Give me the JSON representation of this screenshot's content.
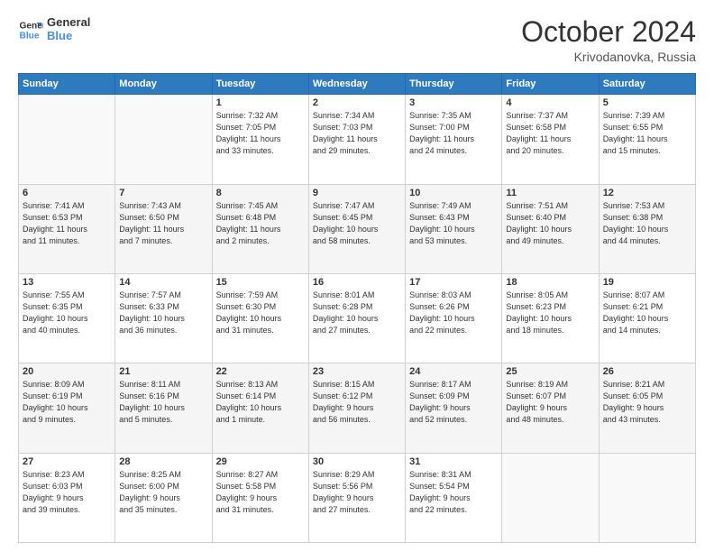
{
  "logo": {
    "line1": "General",
    "line2": "Blue",
    "icon_color": "#4a90d9"
  },
  "header": {
    "month": "October 2024",
    "location": "Krivodanovka, Russia"
  },
  "days_of_week": [
    "Sunday",
    "Monday",
    "Tuesday",
    "Wednesday",
    "Thursday",
    "Friday",
    "Saturday"
  ],
  "weeks": [
    [
      {
        "day": "",
        "info": ""
      },
      {
        "day": "",
        "info": ""
      },
      {
        "day": "1",
        "info": "Sunrise: 7:32 AM\nSunset: 7:05 PM\nDaylight: 11 hours\nand 33 minutes."
      },
      {
        "day": "2",
        "info": "Sunrise: 7:34 AM\nSunset: 7:03 PM\nDaylight: 11 hours\nand 29 minutes."
      },
      {
        "day": "3",
        "info": "Sunrise: 7:35 AM\nSunset: 7:00 PM\nDaylight: 11 hours\nand 24 minutes."
      },
      {
        "day": "4",
        "info": "Sunrise: 7:37 AM\nSunset: 6:58 PM\nDaylight: 11 hours\nand 20 minutes."
      },
      {
        "day": "5",
        "info": "Sunrise: 7:39 AM\nSunset: 6:55 PM\nDaylight: 11 hours\nand 15 minutes."
      }
    ],
    [
      {
        "day": "6",
        "info": "Sunrise: 7:41 AM\nSunset: 6:53 PM\nDaylight: 11 hours\nand 11 minutes."
      },
      {
        "day": "7",
        "info": "Sunrise: 7:43 AM\nSunset: 6:50 PM\nDaylight: 11 hours\nand 7 minutes."
      },
      {
        "day": "8",
        "info": "Sunrise: 7:45 AM\nSunset: 6:48 PM\nDaylight: 11 hours\nand 2 minutes."
      },
      {
        "day": "9",
        "info": "Sunrise: 7:47 AM\nSunset: 6:45 PM\nDaylight: 10 hours\nand 58 minutes."
      },
      {
        "day": "10",
        "info": "Sunrise: 7:49 AM\nSunset: 6:43 PM\nDaylight: 10 hours\nand 53 minutes."
      },
      {
        "day": "11",
        "info": "Sunrise: 7:51 AM\nSunset: 6:40 PM\nDaylight: 10 hours\nand 49 minutes."
      },
      {
        "day": "12",
        "info": "Sunrise: 7:53 AM\nSunset: 6:38 PM\nDaylight: 10 hours\nand 44 minutes."
      }
    ],
    [
      {
        "day": "13",
        "info": "Sunrise: 7:55 AM\nSunset: 6:35 PM\nDaylight: 10 hours\nand 40 minutes."
      },
      {
        "day": "14",
        "info": "Sunrise: 7:57 AM\nSunset: 6:33 PM\nDaylight: 10 hours\nand 36 minutes."
      },
      {
        "day": "15",
        "info": "Sunrise: 7:59 AM\nSunset: 6:30 PM\nDaylight: 10 hours\nand 31 minutes."
      },
      {
        "day": "16",
        "info": "Sunrise: 8:01 AM\nSunset: 6:28 PM\nDaylight: 10 hours\nand 27 minutes."
      },
      {
        "day": "17",
        "info": "Sunrise: 8:03 AM\nSunset: 6:26 PM\nDaylight: 10 hours\nand 22 minutes."
      },
      {
        "day": "18",
        "info": "Sunrise: 8:05 AM\nSunset: 6:23 PM\nDaylight: 10 hours\nand 18 minutes."
      },
      {
        "day": "19",
        "info": "Sunrise: 8:07 AM\nSunset: 6:21 PM\nDaylight: 10 hours\nand 14 minutes."
      }
    ],
    [
      {
        "day": "20",
        "info": "Sunrise: 8:09 AM\nSunset: 6:19 PM\nDaylight: 10 hours\nand 9 minutes."
      },
      {
        "day": "21",
        "info": "Sunrise: 8:11 AM\nSunset: 6:16 PM\nDaylight: 10 hours\nand 5 minutes."
      },
      {
        "day": "22",
        "info": "Sunrise: 8:13 AM\nSunset: 6:14 PM\nDaylight: 10 hours\nand 1 minute."
      },
      {
        "day": "23",
        "info": "Sunrise: 8:15 AM\nSunset: 6:12 PM\nDaylight: 9 hours\nand 56 minutes."
      },
      {
        "day": "24",
        "info": "Sunrise: 8:17 AM\nSunset: 6:09 PM\nDaylight: 9 hours\nand 52 minutes."
      },
      {
        "day": "25",
        "info": "Sunrise: 8:19 AM\nSunset: 6:07 PM\nDaylight: 9 hours\nand 48 minutes."
      },
      {
        "day": "26",
        "info": "Sunrise: 8:21 AM\nSunset: 6:05 PM\nDaylight: 9 hours\nand 43 minutes."
      }
    ],
    [
      {
        "day": "27",
        "info": "Sunrise: 8:23 AM\nSunset: 6:03 PM\nDaylight: 9 hours\nand 39 minutes."
      },
      {
        "day": "28",
        "info": "Sunrise: 8:25 AM\nSunset: 6:00 PM\nDaylight: 9 hours\nand 35 minutes."
      },
      {
        "day": "29",
        "info": "Sunrise: 8:27 AM\nSunset: 5:58 PM\nDaylight: 9 hours\nand 31 minutes."
      },
      {
        "day": "30",
        "info": "Sunrise: 8:29 AM\nSunset: 5:56 PM\nDaylight: 9 hours\nand 27 minutes."
      },
      {
        "day": "31",
        "info": "Sunrise: 8:31 AM\nSunset: 5:54 PM\nDaylight: 9 hours\nand 22 minutes."
      },
      {
        "day": "",
        "info": ""
      },
      {
        "day": "",
        "info": ""
      }
    ]
  ]
}
